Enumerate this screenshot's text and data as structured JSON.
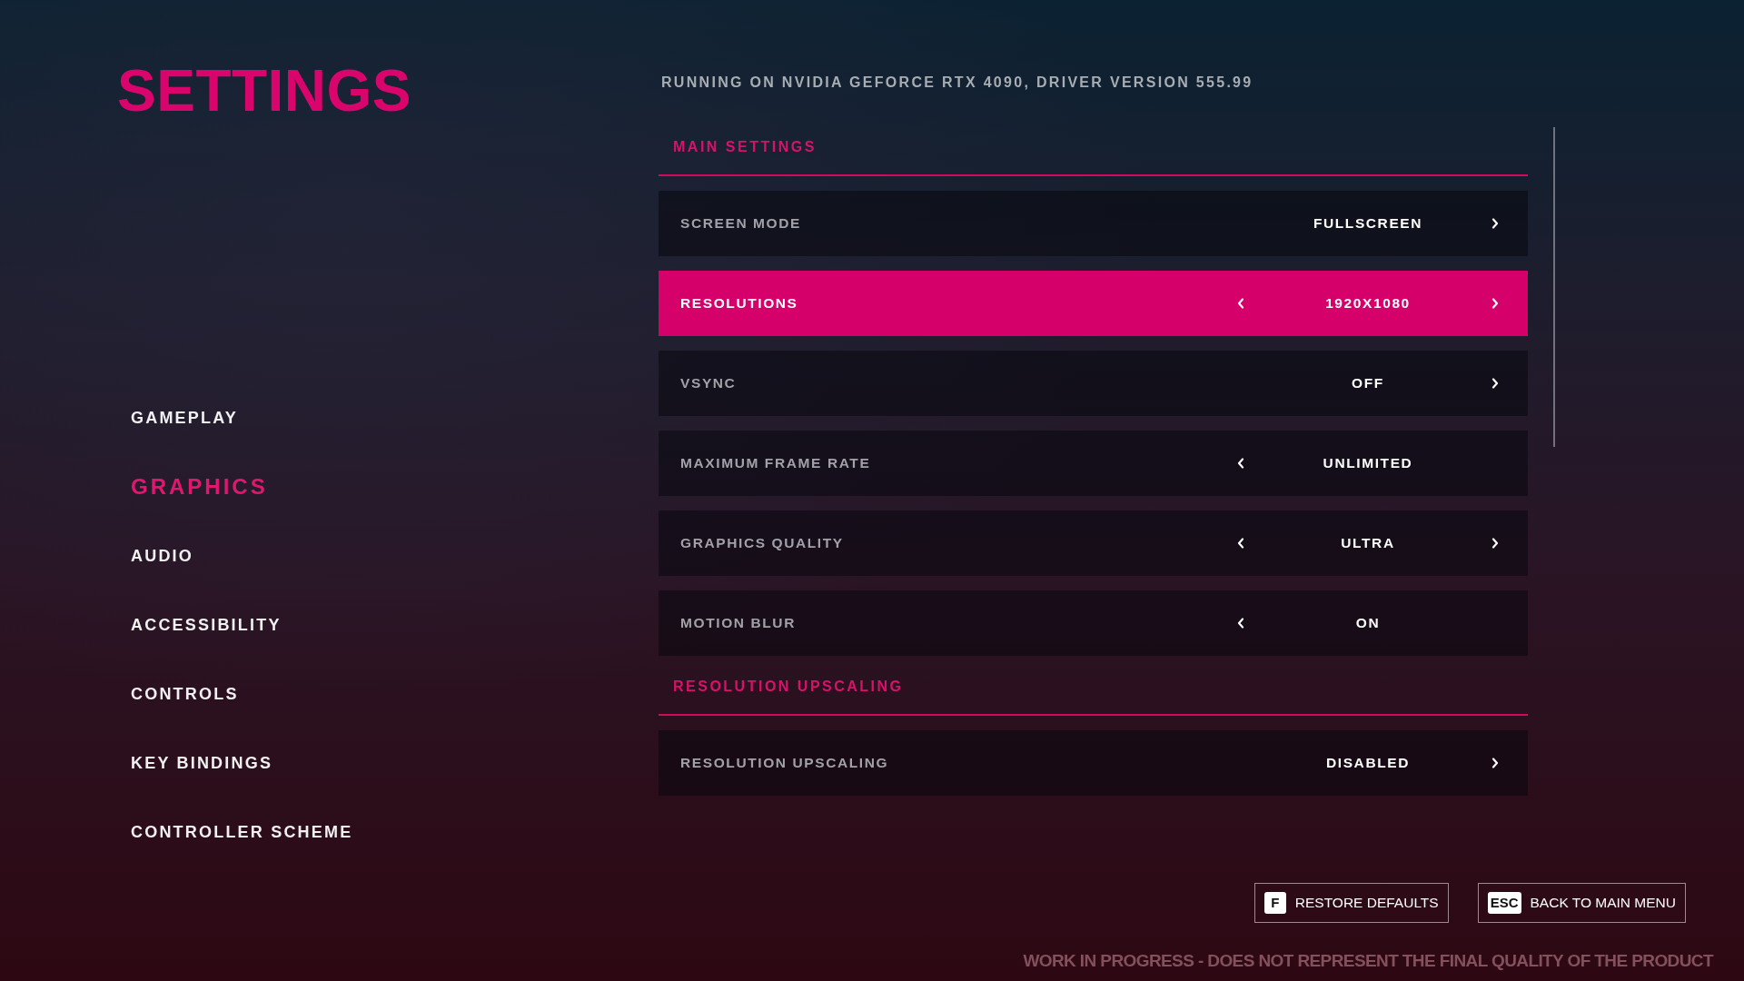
{
  "title": "SETTINGS",
  "nav": [
    {
      "label": "GAMEPLAY",
      "selected": false
    },
    {
      "label": "GRAPHICS",
      "selected": true
    },
    {
      "label": "AUDIO",
      "selected": false
    },
    {
      "label": "ACCESSIBILITY",
      "selected": false
    },
    {
      "label": "CONTROLS",
      "selected": false
    },
    {
      "label": "KEY BINDINGS",
      "selected": false
    },
    {
      "label": "CONTROLLER SCHEME",
      "selected": false
    }
  ],
  "gpu_info": "RUNNING ON NVIDIA GEFORCE RTX 4090, DRIVER VERSION 555.99",
  "sections": [
    {
      "header": "MAIN SETTINGS",
      "rows": [
        {
          "label": "SCREEN MODE",
          "value": "FULLSCREEN",
          "has_left": false,
          "has_right": true,
          "selected": false
        },
        {
          "label": "RESOLUTIONS",
          "value": "1920X1080",
          "has_left": true,
          "has_right": true,
          "selected": true
        },
        {
          "label": "VSYNC",
          "value": "OFF",
          "has_left": false,
          "has_right": true,
          "selected": false
        },
        {
          "label": "MAXIMUM FRAME RATE",
          "value": "UNLIMITED",
          "has_left": true,
          "has_right": false,
          "selected": false
        },
        {
          "label": "GRAPHICS QUALITY",
          "value": "ULTRA",
          "has_left": true,
          "has_right": true,
          "selected": false
        },
        {
          "label": "MOTION BLUR",
          "value": "ON",
          "has_left": true,
          "has_right": false,
          "selected": false
        }
      ]
    },
    {
      "header": "RESOLUTION UPSCALING",
      "rows": [
        {
          "label": "RESOLUTION UPSCALING",
          "value": "DISABLED",
          "has_left": false,
          "has_right": true,
          "selected": false
        }
      ]
    }
  ],
  "buttons": [
    {
      "key": "F",
      "label": "RESTORE DEFAULTS"
    },
    {
      "key": "ESC",
      "label": "BACK TO MAIN MENU"
    }
  ],
  "disclaimer": "WORK IN PROGRESS - DOES NOT REPRESENT THE FINAL QUALITY OF THE PRODUCT"
}
